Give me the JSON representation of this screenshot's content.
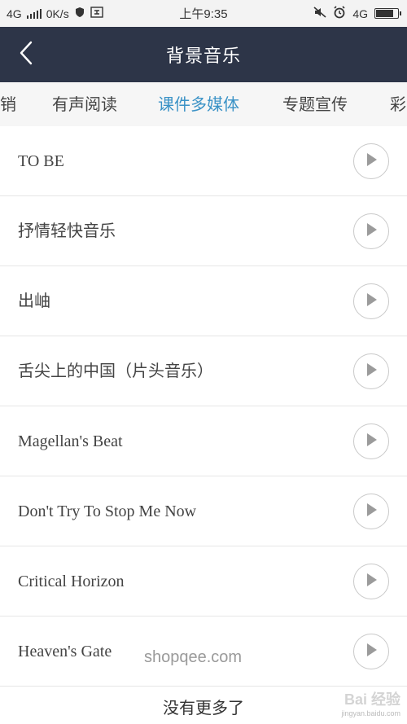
{
  "status_bar": {
    "network_left": "4G",
    "speed": "0K/s",
    "time": "上午9:35",
    "network_right": "4G"
  },
  "nav": {
    "title": "背景音乐"
  },
  "tabs": [
    {
      "label": "销",
      "active": false
    },
    {
      "label": "有声阅读",
      "active": false
    },
    {
      "label": "课件多媒体",
      "active": true
    },
    {
      "label": "专题宣传",
      "active": false
    },
    {
      "label": "彩",
      "active": false
    }
  ],
  "songs": [
    {
      "title": "TO BE"
    },
    {
      "title": "抒情轻快音乐"
    },
    {
      "title": "出岫"
    },
    {
      "title": "舌尖上的中国（片头音乐）"
    },
    {
      "title": "Magellan's Beat"
    },
    {
      "title": "Don't Try To Stop Me Now"
    },
    {
      "title": "Critical Horizon"
    },
    {
      "title": "Heaven's Gate"
    }
  ],
  "footer": {
    "text": "没有更多了"
  },
  "watermarks": {
    "shop": "shopqee.com",
    "baidu_main": "Bai 经验",
    "baidu_sub": "jingyan.baidu.com"
  },
  "colors": {
    "nav_bg": "#2d3548",
    "active_tab": "#3a92c6",
    "status_bar_bg": "#f3f3f3"
  },
  "battery_level": 0.85
}
